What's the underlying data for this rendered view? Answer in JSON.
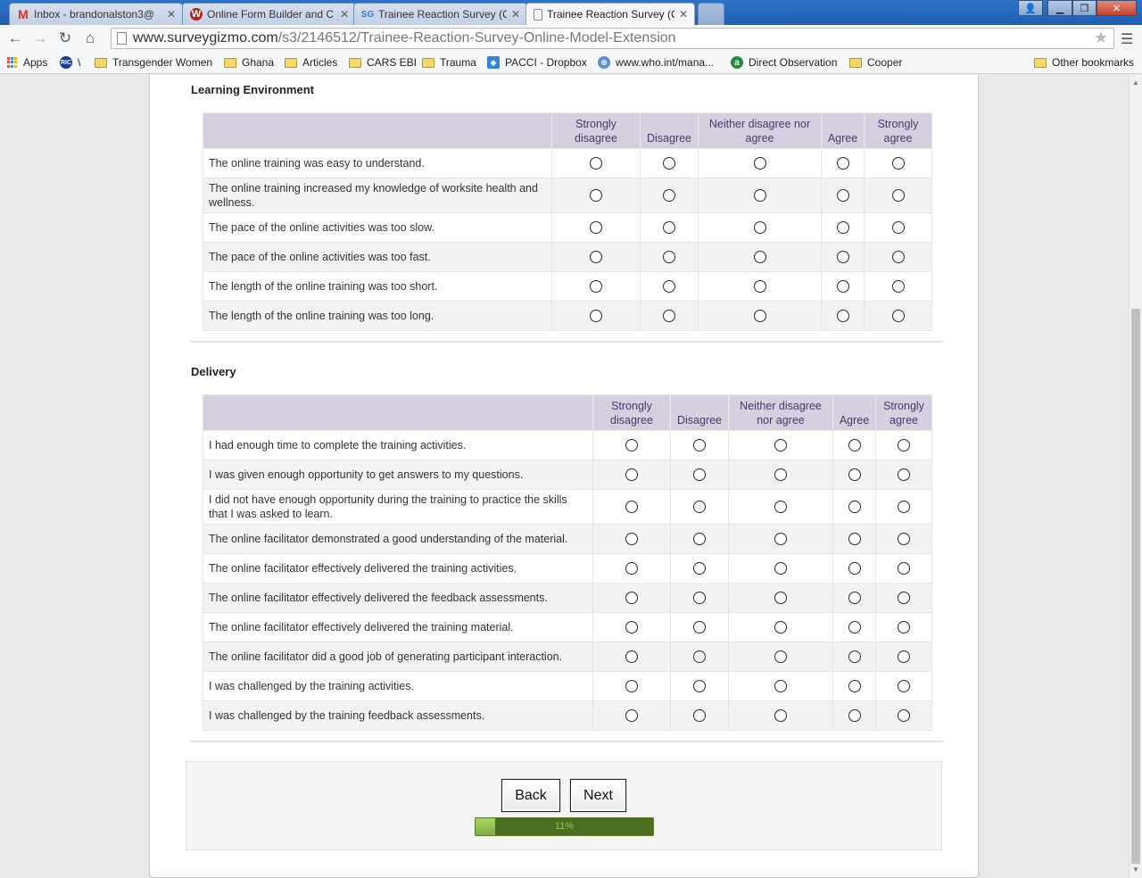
{
  "browser": {
    "tabs": [
      {
        "title": "Inbox - brandonalston3@",
        "favicon": "gmail-icon",
        "color": "#d93025",
        "glyph": "M"
      },
      {
        "title": "Online Form Builder and C",
        "favicon": "wufoo-icon",
        "color": "#b3261e",
        "glyph": "W"
      },
      {
        "title": "Trainee Reaction Survey (C",
        "favicon": "surveygizmo-icon",
        "color": "#2e7fd0",
        "glyph": "SG"
      },
      {
        "title": "Trainee Reaction Survey (C",
        "favicon": "page-icon",
        "color": "#888888",
        "glyph": ""
      }
    ],
    "url_host": "www.surveygizmo.com",
    "url_path": "/s3/2146512/Trainee-Reaction-Survey-Online-Model-Extension",
    "bookmarks": [
      {
        "label": "Apps",
        "icon": "apps-icon"
      },
      {
        "label": "\\",
        "icon": "ric-icon",
        "glyph": "RIC"
      },
      {
        "label": "Transgender Women",
        "icon": "folder-icon"
      },
      {
        "label": "Ghana",
        "icon": "folder-icon"
      },
      {
        "label": "Articles",
        "icon": "folder-icon"
      },
      {
        "label": "CARS EBI",
        "icon": "folder-icon"
      },
      {
        "label": "Trauma",
        "icon": "folder-icon"
      },
      {
        "label": "PACCI - Dropbox",
        "icon": "dropbox-icon"
      },
      {
        "label": "www.who.int/mana...",
        "icon": "who-icon"
      },
      {
        "label": "Direct Observation",
        "icon": "green-a-icon",
        "glyph": "a"
      },
      {
        "label": "Cooper",
        "icon": "folder-icon"
      },
      {
        "label": "Other bookmarks",
        "icon": "folder-icon"
      }
    ]
  },
  "scale": [
    "Strongly disagree",
    "Disagree",
    "Neither disagree nor agree",
    "Agree",
    "Strongly agree"
  ],
  "sections": [
    {
      "title": "Learning Environment",
      "statements": [
        "The online training was easy to understand.",
        "The online training increased my knowledge of worksite health and wellness.",
        "The pace of the online activities was too slow.",
        "The pace of the online activities was too fast.",
        "The length of the online training was too short.",
        "The length of the online training was too long."
      ]
    },
    {
      "title": "Delivery",
      "statements": [
        "I had enough time to complete the training activities.",
        "I was given enough opportunity to get answers to my questions.",
        "I did not have enough opportunity during the training to practice the skills that I was asked to learn.",
        "The online facilitator demonstrated a good understanding of the material.",
        "The online facilitator effectively delivered the training activities.",
        "The online facilitator effectively delivered the feedback assessments.",
        "The online facilitator effectively delivered the training material.",
        "The online facilitator did a good job of generating participant interaction.",
        "I was challenged by the training activities.",
        "I was challenged by the training feedback assessments."
      ]
    }
  ],
  "footer": {
    "back_label": "Back",
    "next_label": "Next",
    "progress_text": "11%",
    "progress_value": 11
  },
  "colors": {
    "header_bg": "#d5cfe0",
    "header_text": "#4a3a67",
    "progress_dark": "#4b6e20",
    "progress_light": "#a9d46b"
  }
}
